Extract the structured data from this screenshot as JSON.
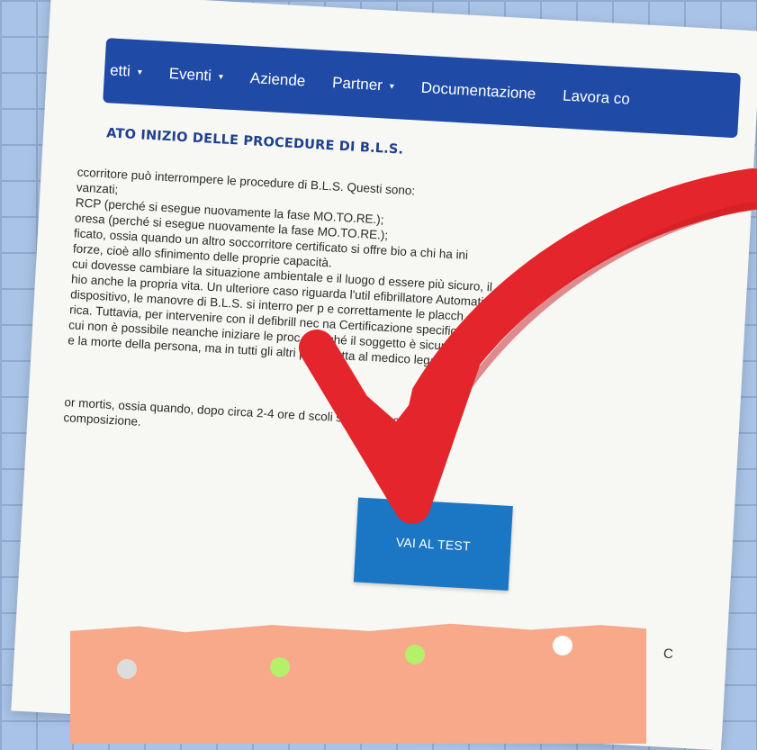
{
  "navbar": {
    "items": [
      {
        "label": "etti",
        "dropdown": true
      },
      {
        "label": "Eventi",
        "dropdown": true
      },
      {
        "label": "Aziende",
        "dropdown": false
      },
      {
        "label": "Partner",
        "dropdown": true
      },
      {
        "label": "Documentazione",
        "dropdown": false
      },
      {
        "label": "Lavora co",
        "dropdown": false
      }
    ],
    "caret": "▾",
    "color": "#1f4aa6"
  },
  "content": {
    "heading": "ATO INIZIO DELLE PROCEDURE DI B.L.S.",
    "lines": [
      "ccorritore può interrompere le procedure di B.L.S. Questi sono:",
      "vanzati;",
      "RCP (perché si esegue nuovamente la fase MO.TO.RE.);",
      "oresa (perché si esegue nuovamente la fase MO.TO.RE.);",
      "ficato, ossia quando un altro soccorritore certificato si offre                       bio a chi ha ini",
      "forze, cioè allo sfinimento delle proprie capacità.",
      "cui dovesse cambiare la situazione ambientale e il luogo d                    essere più sicuro, il",
      "hio anche la propria vita. Un ulteriore caso riguarda l'util                efibrillatore Automatico",
      "dispositivo, le manovre di B.L.S. si interro           per p             e correttamente le placch",
      "rica. Tuttavia, per intervenire con il defibrill            nec            na Certificazione specifica",
      "cui non è possibile neanche iniziare le proc           di B            ché il soggetto è sicurament",
      "e la morte della persona, ma in tutti gli altri                           pito spetta al medico legale. I"
    ],
    "lines_after": [
      "or mortis, ossia quando, dopo circa 2-4 ore d                          scoli si irrigidiscono;",
      "composizione."
    ]
  },
  "test_button": {
    "label": "VAI AL TEST",
    "color": "#1b76c4"
  },
  "corner_text": "C",
  "accent_colors": {
    "arrow": "#e4252b",
    "tape": "#f7a98a",
    "dot_green": "#b4f06a",
    "dot_gray": "#dcdcdc"
  }
}
